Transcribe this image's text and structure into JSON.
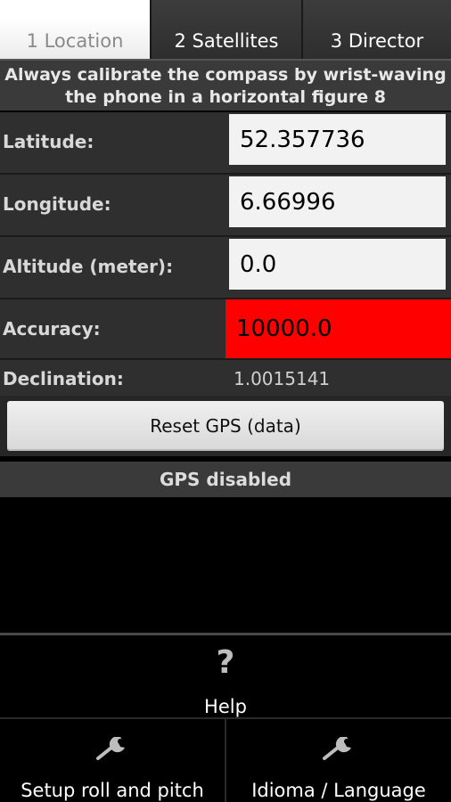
{
  "tabs": [
    {
      "label": "1 Location",
      "active": true
    },
    {
      "label": "2 Satellites",
      "active": false
    },
    {
      "label": "3 Director",
      "active": false
    }
  ],
  "notice": {
    "line1": "Always calibrate the compass by wrist-waving",
    "line2": "the phone in a horizontal figure 8"
  },
  "fields": {
    "latitude": {
      "label": "Latitude:",
      "value": "52.357736"
    },
    "longitude": {
      "label": "Longitude:",
      "value": "6.66996"
    },
    "altitude": {
      "label": "Altitude (meter):",
      "value": "0.0"
    },
    "accuracy": {
      "label": "Accuracy:",
      "value": "10000.0",
      "color": "#ff0000"
    },
    "declination": {
      "label": "Declination:",
      "value": "1.0015141"
    }
  },
  "reset_button": {
    "label": "Reset GPS (data)"
  },
  "status": {
    "text": "GPS disabled"
  },
  "menu": {
    "help": {
      "icon": "question-icon",
      "glyph": "?",
      "label": "Help"
    },
    "setup": {
      "icon": "wrench-icon",
      "label": "Setup roll and pitch"
    },
    "language": {
      "icon": "wrench-icon",
      "label": "Idioma / Language"
    }
  }
}
